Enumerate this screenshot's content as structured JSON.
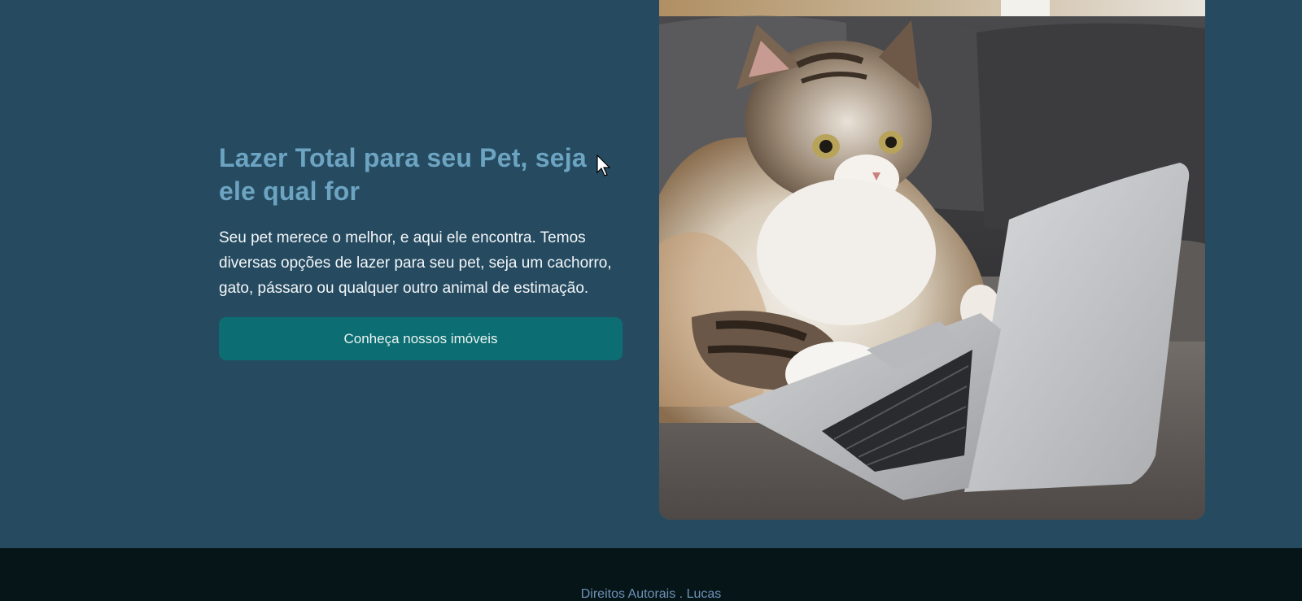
{
  "hero": {
    "title": "Lazer Total para seu Pet, seja ele qual for",
    "description": "Seu pet merece o melhor, e aqui ele encontra. Temos diversas opções de lazer para seu pet, seja um cachorro, gato, pássaro ou qualquer outro animal de estimação.",
    "cta_label": "Conheça nossos imóveis",
    "image_icon": "cat-with-laptop-photo"
  },
  "footer": {
    "copyright": "Direitos Autorais . Lucas"
  },
  "colors": {
    "background": "#264b61",
    "title": "#6ca4c2",
    "button": "#0c6e72",
    "footer_bg": "#061518",
    "footer_text": "#6f91b6"
  }
}
